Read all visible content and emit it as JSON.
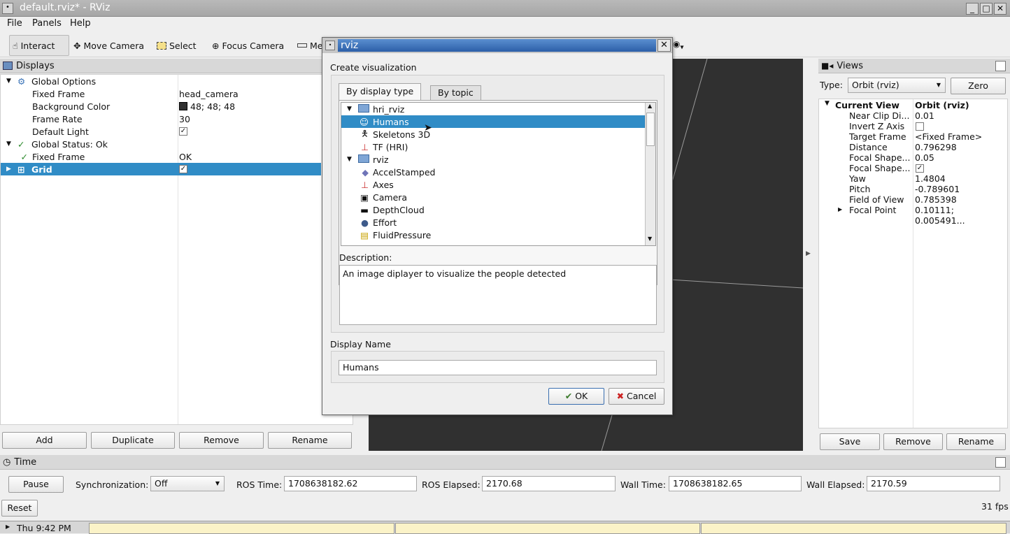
{
  "window": {
    "title": "default.rviz* - RViz"
  },
  "menu": [
    "File",
    "Panels",
    "Help"
  ],
  "toolbar": {
    "tools": [
      "Interact",
      "Move Camera",
      "Select",
      "Focus Camera",
      "Mea"
    ]
  },
  "displays": {
    "title": "Displays",
    "rows": [
      {
        "label": "Global Options",
        "value": ""
      },
      {
        "label": "Fixed Frame",
        "value": "head_camera"
      },
      {
        "label": "Background Color",
        "value": "48; 48; 48"
      },
      {
        "label": "Frame Rate",
        "value": "30"
      },
      {
        "label": "Default Light",
        "value": ""
      },
      {
        "label": "Global Status: Ok",
        "value": ""
      },
      {
        "label": "Fixed Frame",
        "value": "OK"
      },
      {
        "label": "Grid",
        "value": ""
      }
    ],
    "buttons": [
      "Add",
      "Duplicate",
      "Remove",
      "Rename"
    ]
  },
  "dialog": {
    "title": "rviz",
    "heading": "Create visualization",
    "tabs": [
      "By display type",
      "By topic"
    ],
    "groups": [
      {
        "name": "hri_rviz",
        "items": [
          "Humans",
          "Skeletons 3D",
          "TF (HRI)"
        ]
      },
      {
        "name": "rviz",
        "items": [
          "AccelStamped",
          "Axes",
          "Camera",
          "DepthCloud",
          "Effort",
          "FluidPressure"
        ]
      }
    ],
    "selected": "Humans",
    "description_label": "Description:",
    "description": "An image diplayer to visualize the people detected",
    "display_name_label": "Display Name",
    "display_name_value": "Humans",
    "ok": "OK",
    "cancel": "Cancel"
  },
  "views": {
    "title": "Views",
    "type_label": "Type:",
    "type_value": "Orbit (rviz)",
    "zero": "Zero",
    "header": {
      "label": "Current View",
      "value": "Orbit (rviz)"
    },
    "rows": [
      {
        "label": "Near Clip Di...",
        "value": "0.01"
      },
      {
        "label": "Invert Z Axis",
        "value": ""
      },
      {
        "label": "Target Frame",
        "value": "<Fixed Frame>"
      },
      {
        "label": "Distance",
        "value": "0.796298"
      },
      {
        "label": "Focal Shape...",
        "value": "0.05"
      },
      {
        "label": "Focal Shape...",
        "value": ""
      },
      {
        "label": "Yaw",
        "value": "1.4804"
      },
      {
        "label": "Pitch",
        "value": "-0.789601"
      },
      {
        "label": "Field of View",
        "value": "0.785398"
      },
      {
        "label": "Focal Point",
        "value": "0.10111; 0.005491..."
      }
    ],
    "buttons": [
      "Save",
      "Remove",
      "Rename"
    ]
  },
  "time": {
    "title": "Time",
    "pause": "Pause",
    "sync_label": "Synchronization:",
    "sync_value": "Off",
    "ros_time_label": "ROS Time:",
    "ros_time": "1708638182.62",
    "ros_elapsed_label": "ROS Elapsed:",
    "ros_elapsed": "2170.68",
    "wall_time_label": "Wall Time:",
    "wall_time": "1708638182.65",
    "wall_elapsed_label": "Wall Elapsed:",
    "wall_elapsed": "2170.59",
    "reset": "Reset",
    "fps": "31 fps"
  },
  "taskbar": {
    "clock": "Thu  9:42 PM"
  },
  "colors": {
    "selection": "#308cc6",
    "viewport": "#303030",
    "bg_swatch": "#303030"
  }
}
